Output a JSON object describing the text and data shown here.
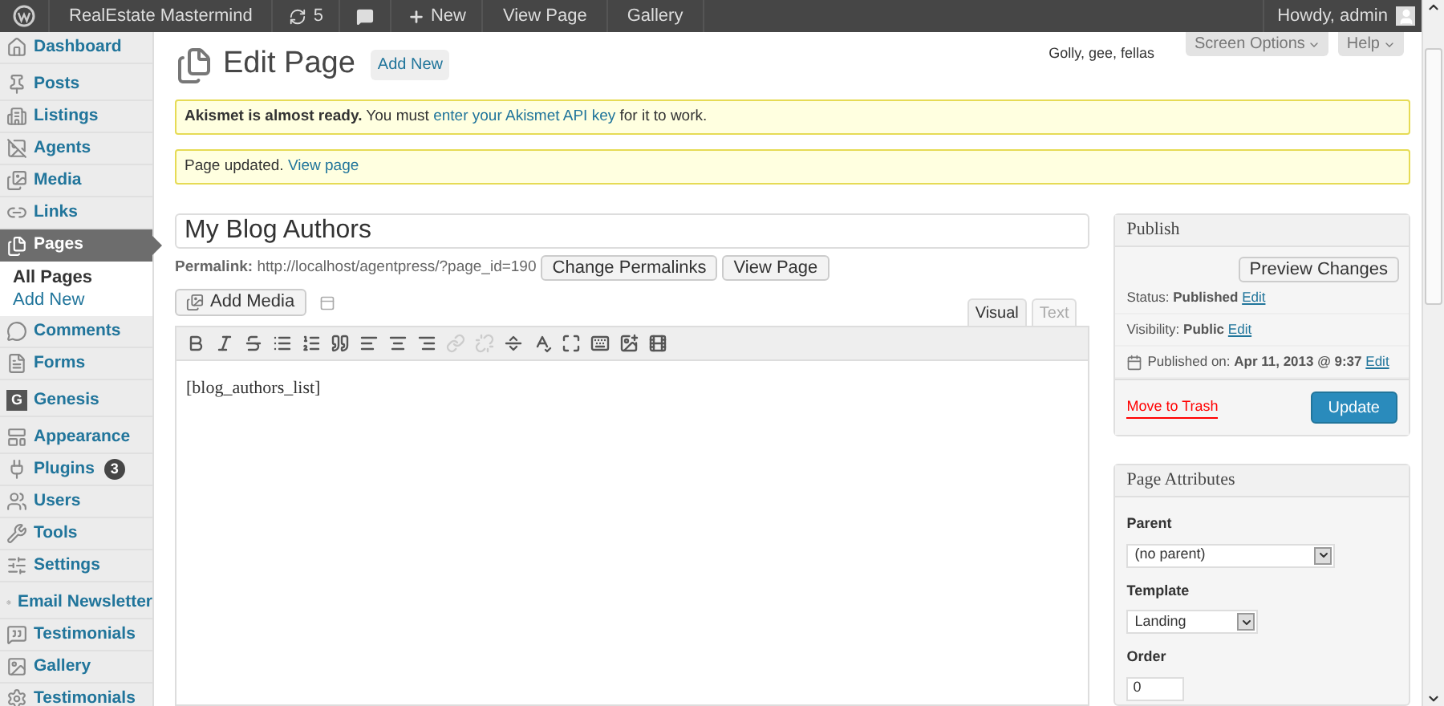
{
  "admin_bar": {
    "site": "RealEstate Mastermind",
    "updates": "5",
    "new": "New",
    "links": [
      "View Page",
      "Gallery"
    ],
    "greeting": "Howdy, admin"
  },
  "sidebar": {
    "groups": [
      {
        "items": [
          {
            "label": "Dashboard",
            "selected": false
          }
        ]
      },
      {
        "items": [
          {
            "label": "Posts",
            "selected": false
          },
          {
            "label": "Listings",
            "selected": false
          },
          {
            "label": "Agents",
            "selected": false
          },
          {
            "label": "Media",
            "selected": false
          },
          {
            "label": "Links",
            "selected": false
          },
          {
            "label": "Pages",
            "selected": true,
            "children": [
              {
                "label": "All Pages",
                "selected": true
              },
              {
                "label": "Add New",
                "selected": false
              }
            ]
          },
          {
            "label": "Comments",
            "selected": false
          },
          {
            "label": "Forms",
            "selected": false
          }
        ]
      },
      {
        "items": [
          {
            "label": "Genesis",
            "selected": false,
            "icon_text": "G"
          }
        ]
      },
      {
        "items": [
          {
            "label": "Appearance",
            "selected": false
          },
          {
            "label": "Plugins",
            "selected": false,
            "badge": "3"
          },
          {
            "label": "Users",
            "selected": false
          },
          {
            "label": "Tools",
            "selected": false
          },
          {
            "label": "Settings",
            "selected": false
          }
        ]
      },
      {
        "items": [
          {
            "label": "Email Newsletter",
            "selected": false
          },
          {
            "label": "Testimonials",
            "selected": false
          },
          {
            "label": "Gallery",
            "selected": false
          },
          {
            "label": "Testimonials",
            "selected": false
          }
        ]
      }
    ]
  },
  "header": {
    "title": "Edit Page",
    "add_new": "Add New",
    "tagline": "Golly, gee, fellas",
    "screen_options": "Screen Options",
    "help": "Help"
  },
  "notices": [
    {
      "before": "**Akismet is almost ready.** You must ",
      "link": "enter your Akismet API key",
      "after": " for it to work."
    },
    {
      "before": "Page updated. ",
      "link": "View page"
    }
  ],
  "editor": {
    "title": "My Blog Authors",
    "permalink_label": "Permalink:",
    "permalink": "http://localhost/agentpress/?page_id=190",
    "buttons": [
      "Change Permalinks",
      "View Page"
    ],
    "add_media": "Add Media",
    "tabs": [
      {
        "label": "Visual",
        "selected": true
      },
      {
        "label": "Text",
        "selected": false
      }
    ],
    "toolbar": [
      {
        "kind": "bold",
        "disabled": false
      },
      {
        "kind": "italic",
        "disabled": false
      },
      {
        "kind": "strike",
        "disabled": false
      },
      {
        "kind": "bullets",
        "disabled": false
      },
      {
        "kind": "numbers",
        "disabled": false
      },
      {
        "kind": "quote",
        "disabled": false
      },
      {
        "kind": "align-left",
        "disabled": false
      },
      {
        "kind": "align-center",
        "disabled": false
      },
      {
        "kind": "align-right",
        "disabled": false
      },
      {
        "kind": "link",
        "disabled": true
      },
      {
        "kind": "unlink",
        "disabled": true
      },
      {
        "kind": "more",
        "disabled": false
      },
      {
        "kind": "spellcheck",
        "disabled": false
      },
      {
        "kind": "fullscreen",
        "disabled": false
      },
      {
        "kind": "kitchen-sink",
        "disabled": false
      },
      {
        "kind": "image",
        "disabled": false
      },
      {
        "kind": "video",
        "disabled": false
      }
    ],
    "content": "[blog_authors_list]"
  },
  "publish": {
    "title": "Publish",
    "preview": "Preview Changes",
    "rows": [
      {
        "text": "Status: **Published**",
        "link": "Edit"
      },
      {
        "text": "Visibility: **Public**",
        "link": "Edit"
      },
      {
        "text": "Published on: **Apr 11, 2013 @ 9:37**",
        "link": "Edit"
      }
    ],
    "trash": "Move to Trash",
    "update": "Update"
  },
  "page_attributes": {
    "title": "Page Attributes",
    "fields": [
      {
        "label": "Parent",
        "kind": "select",
        "value": "(no parent)"
      },
      {
        "label": "Template",
        "kind": "select",
        "value": "Landing"
      },
      {
        "label": "Order",
        "kind": "input",
        "value": "0"
      }
    ]
  }
}
